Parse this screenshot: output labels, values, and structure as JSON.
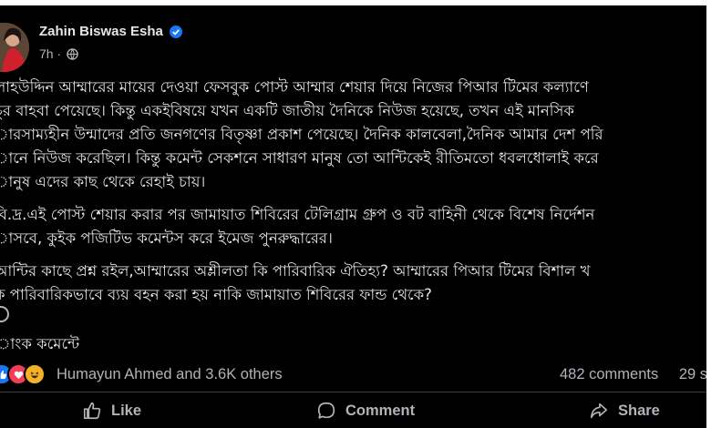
{
  "post": {
    "author": "Zahin Biswas Esha",
    "time": "7h",
    "separator": "·",
    "body_lines": [
      "লাহউদ্দিন আম্মারের মায়ের দেওয়া ফেসবুক পোস্ট আম্মার শেয়ার দিয়ে নিজের পিআর টিমের কল্যাণে",
      "চুর বাহবা পেয়েছে। কিন্তু একইবিষয়ে যখন একটি জাতীয় দৈনিকে নিউজ হয়েছে, তখন এই মানসিক",
      "ারসাম্যহীন উন্মাদের প্রতি জনগণের বিতৃষ্ণা প্রকাশ পেয়েছে। দৈনিক কালবেলা,দৈনিক আমার দেশ পরি",
      "ানে নিউজ করেছিল। কিন্তু কমেন্ট সেকশনে সাধারণ মানুষ তো আন্টিকেই রীতিমতো ধবলধোলাই করে",
      "ানুষ এদের কাছ থেকে রেহাই চায়।",
      "বি.দ্র.এই পোস্ট শেয়ার করার পর জামায়াত শিবিরের টেলিগ্রাম গ্রুপ ও বট বাহিনী থেকে বিশেষ নির্দেশন",
      "াসবে, কুইক পজিটিভ কমেন্টস করে ইমেজ পুনরুদ্ধারের।",
      "আন্টির কাছে প্রশ্ন রইল,আম্মারের অশ্লীলতা কি পারিবারিক ঐতিহ্য? আম্মারের পিআর টিমের বিশাল খ",
      "ক পারিবারিকভাবে ব্যয় বহন করা হয় নাকি জামায়াত শিবিরের ফান্ড থেকে?"
    ],
    "link_comment": "াংক কমেন্টে",
    "reactors": "Humayun Ahmed and 3.6K others",
    "comments_count": "482 comments",
    "shares_count": "29 s",
    "actions": {
      "like": "Like",
      "comment": "Comment",
      "share": "Share"
    }
  },
  "colors": {
    "background": "#000000",
    "text_primary": "#e4e6eb",
    "text_secondary": "#b0b3b8",
    "verified": "#1877f2",
    "divider": "#3e4042"
  },
  "icons": [
    "verified-badge-icon",
    "globe-icon",
    "like-reaction-icon",
    "love-reaction-icon",
    "haha-reaction-icon",
    "thumbs-up-icon",
    "comment-bubble-icon",
    "share-arrow-icon"
  ]
}
